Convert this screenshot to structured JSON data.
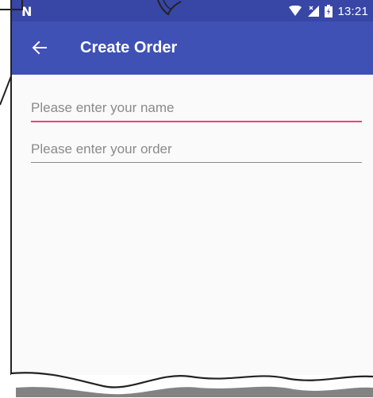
{
  "status_bar": {
    "left_glyph": "N",
    "time": "13:21",
    "icons": [
      "wifi-icon",
      "no-signal-icon",
      "battery-icon"
    ]
  },
  "app_bar": {
    "title": "Create Order",
    "back_icon": "arrow-left-icon"
  },
  "form": {
    "name_field": {
      "placeholder": "Please enter your name",
      "value": ""
    },
    "order_field": {
      "placeholder": "Please enter your order",
      "value": ""
    }
  },
  "colors": {
    "status_bar": "#3846a6",
    "app_bar": "#3f51b5",
    "focused_underline": "#ec407a",
    "underline": "#8a8a8a",
    "background": "#fafafa"
  }
}
